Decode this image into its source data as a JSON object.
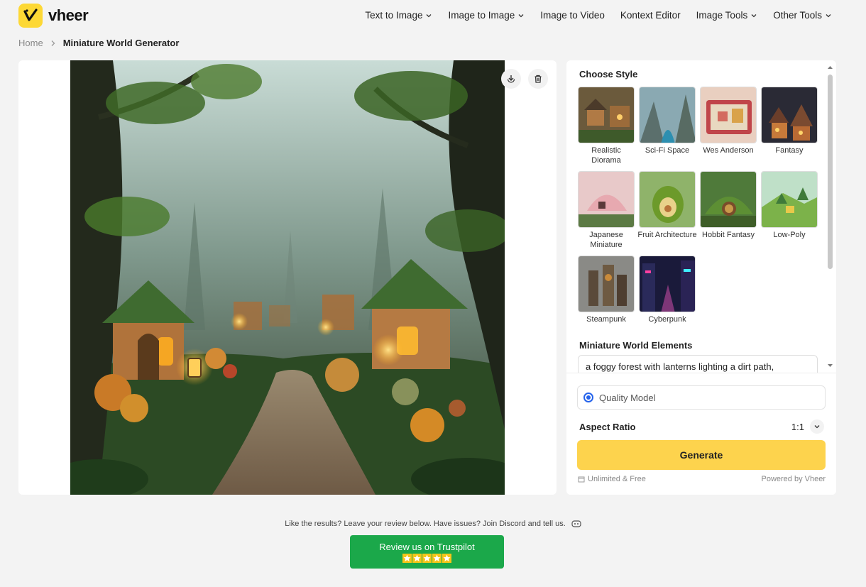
{
  "brand": {
    "name": "vheer",
    "logo_color": "#fdd835"
  },
  "nav": {
    "items": [
      {
        "label": "Text to Image",
        "has_dropdown": true
      },
      {
        "label": "Image to Image",
        "has_dropdown": true
      },
      {
        "label": "Image to Video",
        "has_dropdown": false
      },
      {
        "label": "Kontext Editor",
        "has_dropdown": false
      },
      {
        "label": "Image Tools",
        "has_dropdown": true
      },
      {
        "label": "Other Tools",
        "has_dropdown": true
      }
    ]
  },
  "breadcrumb": {
    "home": "Home",
    "current": "Miniature World Generator"
  },
  "image_panel": {
    "download_icon": "download-icon",
    "delete_icon": "trash-icon"
  },
  "styles": {
    "title": "Choose Style",
    "items": [
      {
        "label": "Realistic Diorama"
      },
      {
        "label": "Sci-Fi Space"
      },
      {
        "label": "Wes Anderson"
      },
      {
        "label": "Fantasy"
      },
      {
        "label": "Japanese Miniature"
      },
      {
        "label": "Fruit Architecture"
      },
      {
        "label": "Hobbit Fantasy"
      },
      {
        "label": "Low-Poly"
      },
      {
        "label": "Steampunk"
      },
      {
        "label": "Cyberpunk"
      }
    ]
  },
  "elements": {
    "title": "Miniature World Elements",
    "value": "a foggy forest with lanterns lighting a dirt path,"
  },
  "model": {
    "label": "Quality Model",
    "accent": "#2563eb"
  },
  "aspect": {
    "label": "Aspect Ratio",
    "value": "1:1"
  },
  "generate": {
    "label": "Generate",
    "color": "#fdd34d"
  },
  "footer": {
    "left": "Unlimited & Free",
    "right": "Powered by Vheer"
  },
  "review": {
    "text": "Like the results? Leave your review below. Have issues? Join Discord and tell us.",
    "button": "Review us on Trustpilot",
    "stars": 5,
    "button_color": "#1ba84a"
  }
}
